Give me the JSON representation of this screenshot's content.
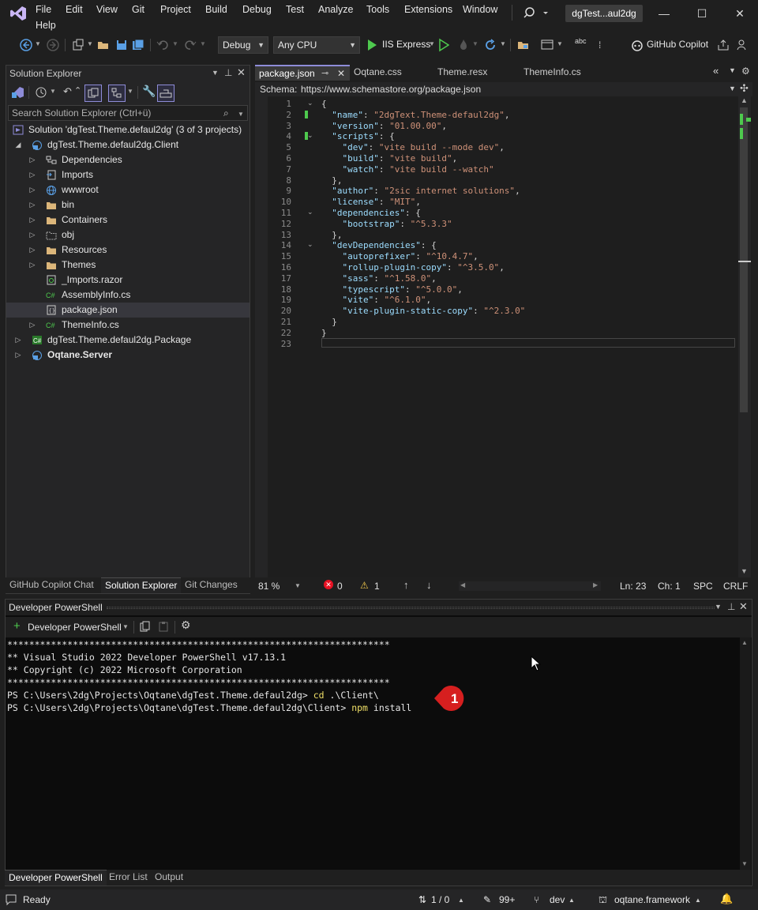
{
  "menu": {
    "items": [
      "File",
      "Edit",
      "View",
      "Git",
      "Project",
      "Build",
      "Debug",
      "Test",
      "Analyze",
      "Tools",
      "Extensions",
      "Window",
      "Help"
    ],
    "solution_badge": "dgTest...aul2dg"
  },
  "toolbar": {
    "config": "Debug",
    "platform": "Any CPU",
    "run_target": "IIS Express",
    "copilot": "GitHub Copilot"
  },
  "solution_explorer": {
    "title": "Solution Explorer",
    "search_placeholder": "Search Solution Explorer (Ctrl+ü)",
    "items": [
      {
        "label": "Solution 'dgTest.Theme.defaul2dg' (3 of 3 projects)",
        "level": 0,
        "icon": "solution-icon",
        "chev": ""
      },
      {
        "label": "dgTest.Theme.defaul2dg.Client",
        "level": 1,
        "icon": "web-project-icon",
        "chev": "open"
      },
      {
        "label": "Dependencies",
        "level": 2,
        "icon": "dependencies-icon",
        "chev": "closed"
      },
      {
        "label": "Imports",
        "level": 2,
        "icon": "imports-icon",
        "chev": "closed"
      },
      {
        "label": "wwwroot",
        "level": 2,
        "icon": "globe-icon",
        "chev": "closed"
      },
      {
        "label": "bin",
        "level": 2,
        "icon": "folder-icon",
        "chev": "closed"
      },
      {
        "label": "Containers",
        "level": 2,
        "icon": "folder-icon",
        "chev": "closed"
      },
      {
        "label": "obj",
        "level": 2,
        "icon": "folder-outline-icon",
        "chev": "closed"
      },
      {
        "label": "Resources",
        "level": 2,
        "icon": "folder-icon",
        "chev": "closed"
      },
      {
        "label": "Themes",
        "level": 2,
        "icon": "folder-icon",
        "chev": "closed"
      },
      {
        "label": "_Imports.razor",
        "level": 2,
        "icon": "razor-file-icon",
        "chev": ""
      },
      {
        "label": "AssemblyInfo.cs",
        "level": 2,
        "icon": "csharp-file-icon",
        "chev": ""
      },
      {
        "label": "package.json",
        "level": 2,
        "icon": "json-file-icon",
        "chev": "",
        "selected": true
      },
      {
        "label": "ThemeInfo.cs",
        "level": 2,
        "icon": "csharp-file-icon",
        "chev": "closed"
      },
      {
        "label": "dgTest.Theme.defaul2dg.Package",
        "level": 1,
        "icon": "csharp-project-icon",
        "chev": "closed"
      },
      {
        "label": "Oqtane.Server",
        "level": 1,
        "icon": "web-project-icon",
        "chev": "closed",
        "bold": true
      }
    ],
    "bottom_tabs": [
      "GitHub Copilot Chat",
      "Solution Explorer",
      "Git Changes"
    ]
  },
  "editor": {
    "tabs": [
      "package.json",
      "Oqtane.css",
      "Theme.resx",
      "ThemeInfo.cs"
    ],
    "schema_label": "Schema:",
    "schema_url": "https://www.schemastore.org/package.json",
    "lines": [
      "{",
      "  \"name\": \"2dgText.Theme-defaul2dg\",",
      "  \"version\": \"01.00.00\",",
      "  \"scripts\": {",
      "    \"dev\": \"vite build --mode dev\",",
      "    \"build\": \"vite build\",",
      "    \"watch\": \"vite build --watch\"",
      "  },",
      "  \"author\": \"2sic internet solutions\",",
      "  \"license\": \"MIT\",",
      "  \"dependencies\": {",
      "    \"bootstrap\": \"^5.3.3\"",
      "  },",
      "  \"devDependencies\": {",
      "    \"autoprefixer\": \"^10.4.7\",",
      "    \"rollup-plugin-copy\": \"^3.5.0\",",
      "    \"sass\": \"^1.58.0\",",
      "    \"typescript\": \"^5.0.0\",",
      "    \"vite\": \"^6.1.0\",",
      "    \"vite-plugin-static-copy\": \"^2.3.0\"",
      "  }",
      "}",
      ""
    ],
    "status": {
      "zoom": "81 %",
      "errors": "0",
      "warnings": "1",
      "line": "Ln: 23",
      "col": "Ch: 1",
      "spc": "SPC",
      "eol": "CRLF"
    }
  },
  "powershell": {
    "title": "Developer PowerShell",
    "dropdown": "Developer PowerShell",
    "lines": [
      "**********************************************************************",
      "** Visual Studio 2022 Developer PowerShell v17.13.1",
      "** Copyright (c) 2022 Microsoft Corporation",
      "**********************************************************************"
    ],
    "prompt1": "PS C:\\Users\\2dg\\Projects\\Oqtane\\dgTest.Theme.defaul2dg> ",
    "cmd1": "cd",
    "arg1": " .\\Client\\",
    "prompt2": "PS C:\\Users\\2dg\\Projects\\Oqtane\\dgTest.Theme.defaul2dg\\Client> ",
    "cmd2": "npm",
    "arg2": " install",
    "badge": "1",
    "bottom_tabs": [
      "Developer PowerShell",
      "Error List",
      "Output"
    ]
  },
  "statusbar": {
    "ready": "Ready",
    "lines": "1 / 0",
    "pending": "99+",
    "branch": "dev",
    "repo": "oqtane.framework"
  },
  "colors": {
    "accent": "#8e8cd8",
    "badge_red": "#d61f1f",
    "json_key": "#9cdcfe",
    "json_string": "#ce9178",
    "terminal_cmd": "#f0e068"
  }
}
